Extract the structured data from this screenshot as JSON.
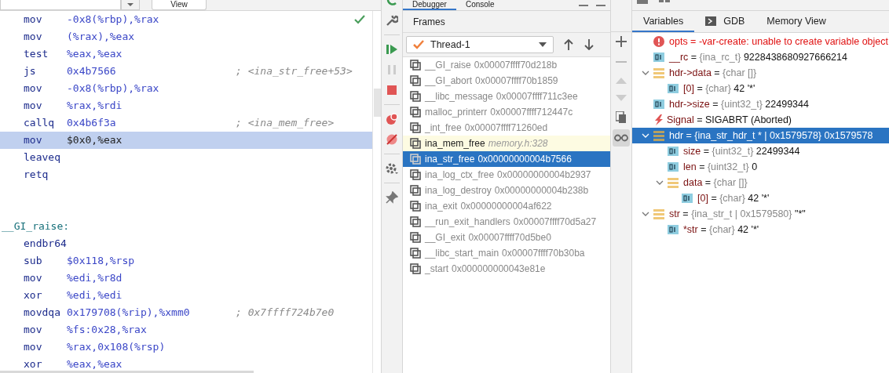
{
  "editor": {
    "toolbar": {
      "view_button": "View"
    },
    "lines": [
      {
        "kind": "instr",
        "mnemonic": "mov",
        "operand": "-0x8(%rbp),%rax",
        "selected": false
      },
      {
        "kind": "instr",
        "mnemonic": "mov",
        "operand": "(%rax),%eax",
        "selected": false
      },
      {
        "kind": "instr",
        "mnemonic": "test",
        "operand": "%eax,%eax",
        "selected": false
      },
      {
        "kind": "instr",
        "mnemonic": "js",
        "operand": "0x4b7566",
        "comment": "; <ina_str_free+53>",
        "selected": false
      },
      {
        "kind": "instr",
        "mnemonic": "mov",
        "operand": "-0x8(%rbp),%rax",
        "selected": false
      },
      {
        "kind": "instr",
        "mnemonic": "mov",
        "operand": "%rax,%rdi",
        "selected": false
      },
      {
        "kind": "instr",
        "mnemonic": "callq",
        "operand": "0x4b6f3a",
        "comment": "; <ina_mem_free>",
        "selected": false
      },
      {
        "kind": "instr",
        "mnemonic": "mov",
        "operand": "$0x0,%eax",
        "selected": true
      },
      {
        "kind": "instr",
        "mnemonic": "leaveq",
        "selected": false
      },
      {
        "kind": "instr",
        "mnemonic": "retq",
        "selected": false
      },
      {
        "kind": "blank",
        "selected": false
      },
      {
        "kind": "blank",
        "selected": false
      },
      {
        "kind": "label",
        "text": "__GI_raise:",
        "selected": false
      },
      {
        "kind": "instr",
        "mnemonic": "endbr64",
        "selected": false
      },
      {
        "kind": "instr",
        "mnemonic": "sub",
        "operand": "$0x118,%rsp",
        "selected": false
      },
      {
        "kind": "instr",
        "mnemonic": "mov",
        "operand": "%edi,%r8d",
        "selected": false
      },
      {
        "kind": "instr",
        "mnemonic": "xor",
        "operand": "%edi,%edi",
        "selected": false
      },
      {
        "kind": "instr",
        "mnemonic": "movdqa",
        "operand": "0x179708(%rip),%xmm0",
        "comment": "; 0x7ffff724b7e0",
        "selected": false
      },
      {
        "kind": "instr",
        "mnemonic": "mov",
        "operand": "%fs:0x28,%rax",
        "selected": false
      },
      {
        "kind": "instr",
        "mnemonic": "mov",
        "operand": "%rax,0x108(%rsp)",
        "selected": false
      },
      {
        "kind": "instr",
        "mnemonic": "xor",
        "operand": "%eax,%eax",
        "selected": false
      }
    ]
  },
  "debug_tabs": [
    {
      "label": "Debugger",
      "selected": true
    },
    {
      "label": "Console",
      "selected": false
    }
  ],
  "frames": {
    "title": "Frames",
    "thread": "Thread-1",
    "items": [
      {
        "function": "__GI_raise",
        "location": "0x00007ffff70d218b",
        "kind": "address",
        "highlighted": false,
        "selected": false
      },
      {
        "function": "__GI_abort",
        "location": "0x00007ffff70b1859",
        "kind": "address",
        "highlighted": false,
        "selected": false
      },
      {
        "function": "__libc_message",
        "location": "0x00007ffff711c3ee",
        "kind": "address",
        "highlighted": false,
        "selected": false
      },
      {
        "function": "malloc_printerr",
        "location": "0x00007ffff712447c",
        "kind": "address",
        "highlighted": false,
        "selected": false
      },
      {
        "function": "_int_free",
        "location": "0x00007ffff71260ed",
        "kind": "address",
        "highlighted": false,
        "selected": false
      },
      {
        "function": "ina_mem_free",
        "location": "memory.h:328",
        "kind": "source",
        "highlighted": true,
        "selected": false
      },
      {
        "function": "ina_str_free",
        "location": "0x00000000004b7566",
        "kind": "address",
        "highlighted": false,
        "selected": true
      },
      {
        "function": "ina_log_ctx_free",
        "location": "0x00000000004b2937",
        "kind": "address",
        "highlighted": false,
        "selected": false
      },
      {
        "function": "ina_log_destroy",
        "location": "0x00000000004b238b",
        "kind": "address",
        "highlighted": false,
        "selected": false
      },
      {
        "function": "ina_exit",
        "location": "0x00000000004af622",
        "kind": "address",
        "highlighted": false,
        "selected": false
      },
      {
        "function": "__run_exit_handlers",
        "location": "0x00007ffff70d5a27",
        "kind": "address",
        "highlighted": false,
        "selected": false
      },
      {
        "function": "__GI_exit",
        "location": "0x00007ffff70d5be0",
        "kind": "address",
        "highlighted": false,
        "selected": false
      },
      {
        "function": "__libc_start_main",
        "location": "0x00007ffff70b30ba",
        "kind": "address",
        "highlighted": false,
        "selected": false
      },
      {
        "function": "_start",
        "location": "0x000000000043e81e",
        "kind": "address",
        "highlighted": false,
        "selected": false
      }
    ]
  },
  "variables": {
    "tabs": [
      {
        "label": "Variables",
        "selected": true
      },
      {
        "label": "GDB",
        "selected": false
      },
      {
        "label": "Memory View",
        "selected": false
      }
    ],
    "items": [
      {
        "kind": "error",
        "name": "opts",
        "op": "=",
        "value": "-var-create: unable to create variable object",
        "selected": false
      },
      {
        "kind": "scalar",
        "name": "__rc",
        "op": "=",
        "type": "{ina_rc_t}",
        "value": "9228438680927666214",
        "selected": false
      },
      {
        "kind": "array",
        "name": "hdr->data",
        "op": "=",
        "type": "{char []}",
        "expanded": true,
        "selected": false,
        "children": [
          {
            "kind": "scalar",
            "name": "[0]",
            "op": "=",
            "type": "{char}",
            "value": "42 '*'",
            "selected": false
          }
        ]
      },
      {
        "kind": "scalar",
        "name": "hdr->size",
        "op": "=",
        "type": "{uint32_t}",
        "value": "22499344",
        "selected": false
      },
      {
        "kind": "signal",
        "name": "Signal",
        "op": "=",
        "value": "SIGABRT (Aborted)",
        "selected": false
      },
      {
        "kind": "struct",
        "name": "hdr",
        "op": "=",
        "type": "{ina_str_hdr_t * | 0x1579578}",
        "value": "0x1579578",
        "expanded": true,
        "selected": true,
        "children": [
          {
            "kind": "scalar",
            "name": "size",
            "op": "=",
            "type": "{uint32_t}",
            "value": "22499344",
            "selected": false
          },
          {
            "kind": "scalar",
            "name": "len",
            "op": "=",
            "type": "{uint32_t}",
            "value": "0",
            "selected": false
          },
          {
            "kind": "array",
            "name": "data",
            "op": "=",
            "type": "{char []}",
            "expanded": true,
            "selected": false,
            "children": [
              {
                "kind": "scalar",
                "name": "[0]",
                "op": "=",
                "type": "{char}",
                "value": "42 '*'",
                "selected": false
              }
            ]
          }
        ]
      },
      {
        "kind": "struct",
        "name": "str",
        "op": "=",
        "type": "{ina_str_t | 0x1579580}",
        "value": "\"*\"",
        "expanded": true,
        "selected": false,
        "children": [
          {
            "kind": "scalar",
            "name": "*str",
            "op": "=",
            "type": "{char}",
            "value": "42 '*'",
            "selected": false
          }
        ]
      }
    ]
  }
}
